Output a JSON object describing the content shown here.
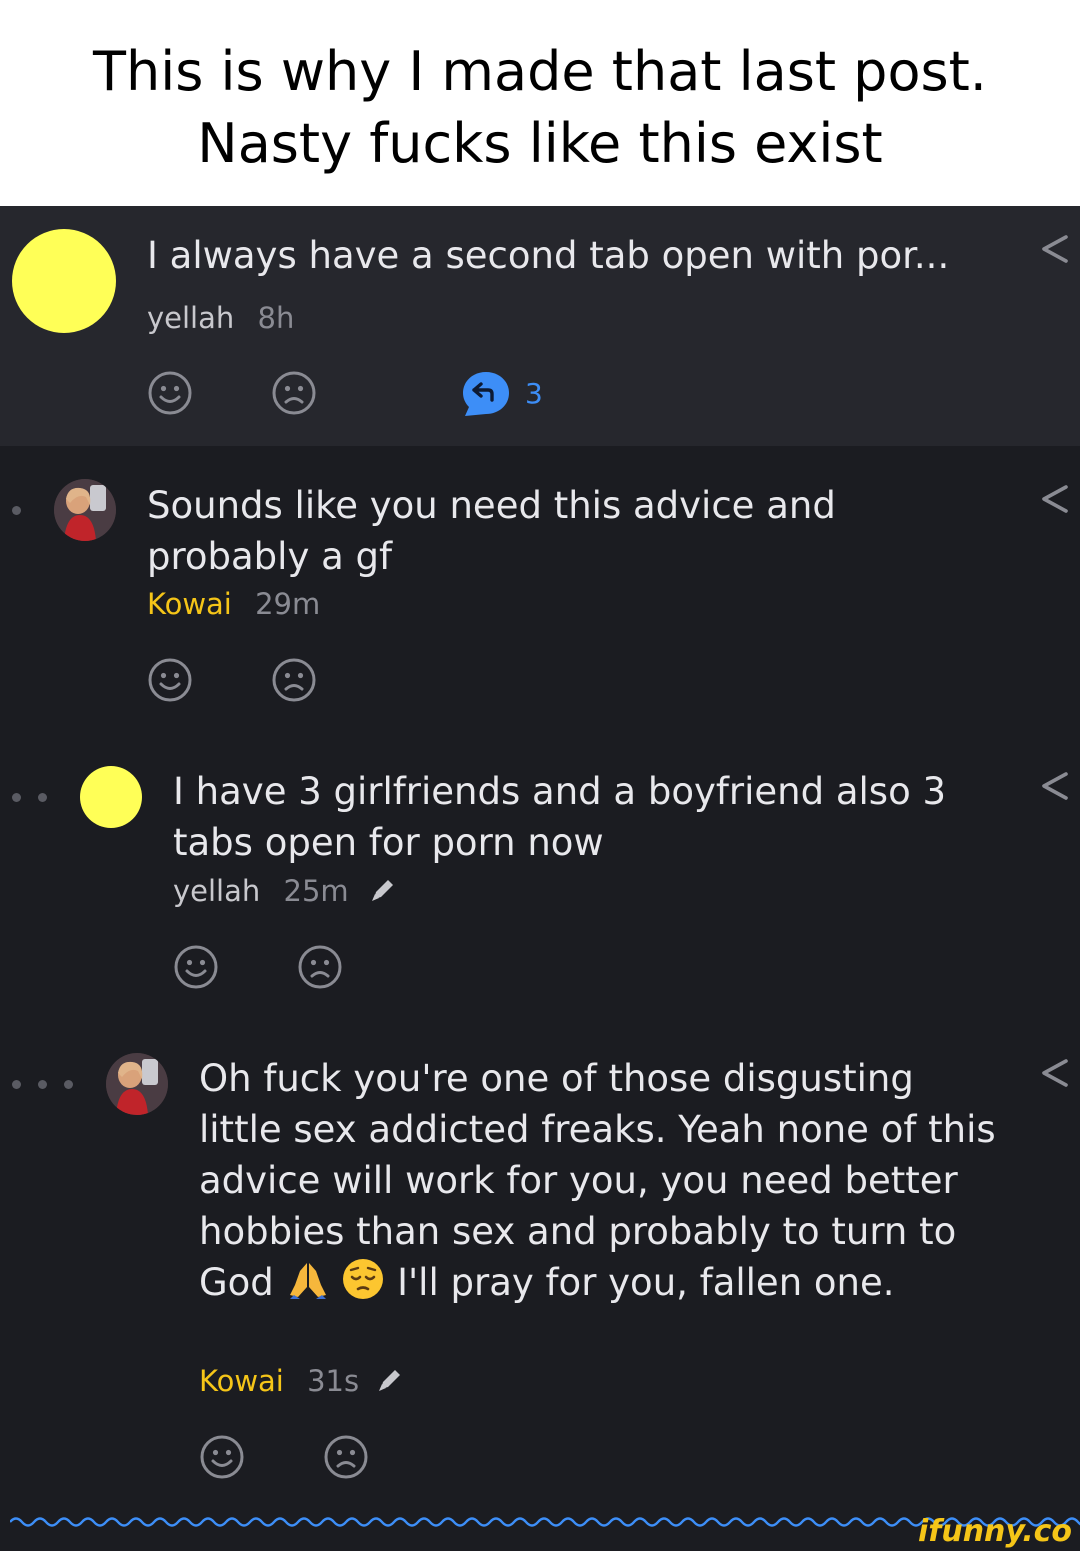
{
  "caption": {
    "line1": "This is why I made that last post.",
    "line2": "Nasty fucks like this exist"
  },
  "colors": {
    "background": "#1b1c21",
    "op_background": "#26272d",
    "accent_yellow": "#f5c518",
    "reply_blue": "#3d8ef7",
    "avatar_yellow": "#ffff57"
  },
  "comments": [
    {
      "text": "I always have a second tab open with por...",
      "author": "yellah",
      "time": "8h",
      "replies": "3",
      "icons": [
        "smile-icon",
        "frown-icon",
        "reply-icon",
        "share-icon"
      ]
    },
    {
      "text": "Sounds like you need this advice and probably a gf",
      "author": "Kowai",
      "time": "29m",
      "icons": [
        "smile-icon",
        "frown-icon",
        "share-icon"
      ]
    },
    {
      "text": "I have 3 girlfriends and a boyfriend also 3 tabs open for porn now",
      "author": "yellah",
      "time": "25m",
      "icons": [
        "smile-icon",
        "frown-icon",
        "share-icon",
        "pencil-icon"
      ]
    },
    {
      "text_part1": "Oh fuck you're one of those disgusting little sex addicted freaks. Yeah none of this advice will work for you, you need better hobbies than sex and probably to turn to God",
      "text_part2": "I'll pray for you, fallen one.",
      "emojis": [
        "praying-hands-icon",
        "pensive-face-icon"
      ],
      "author": "Kowai",
      "time": "31s",
      "icons": [
        "smile-icon",
        "frown-icon",
        "share-icon",
        "pencil-icon"
      ]
    }
  ],
  "watermark": "ifunny.co"
}
